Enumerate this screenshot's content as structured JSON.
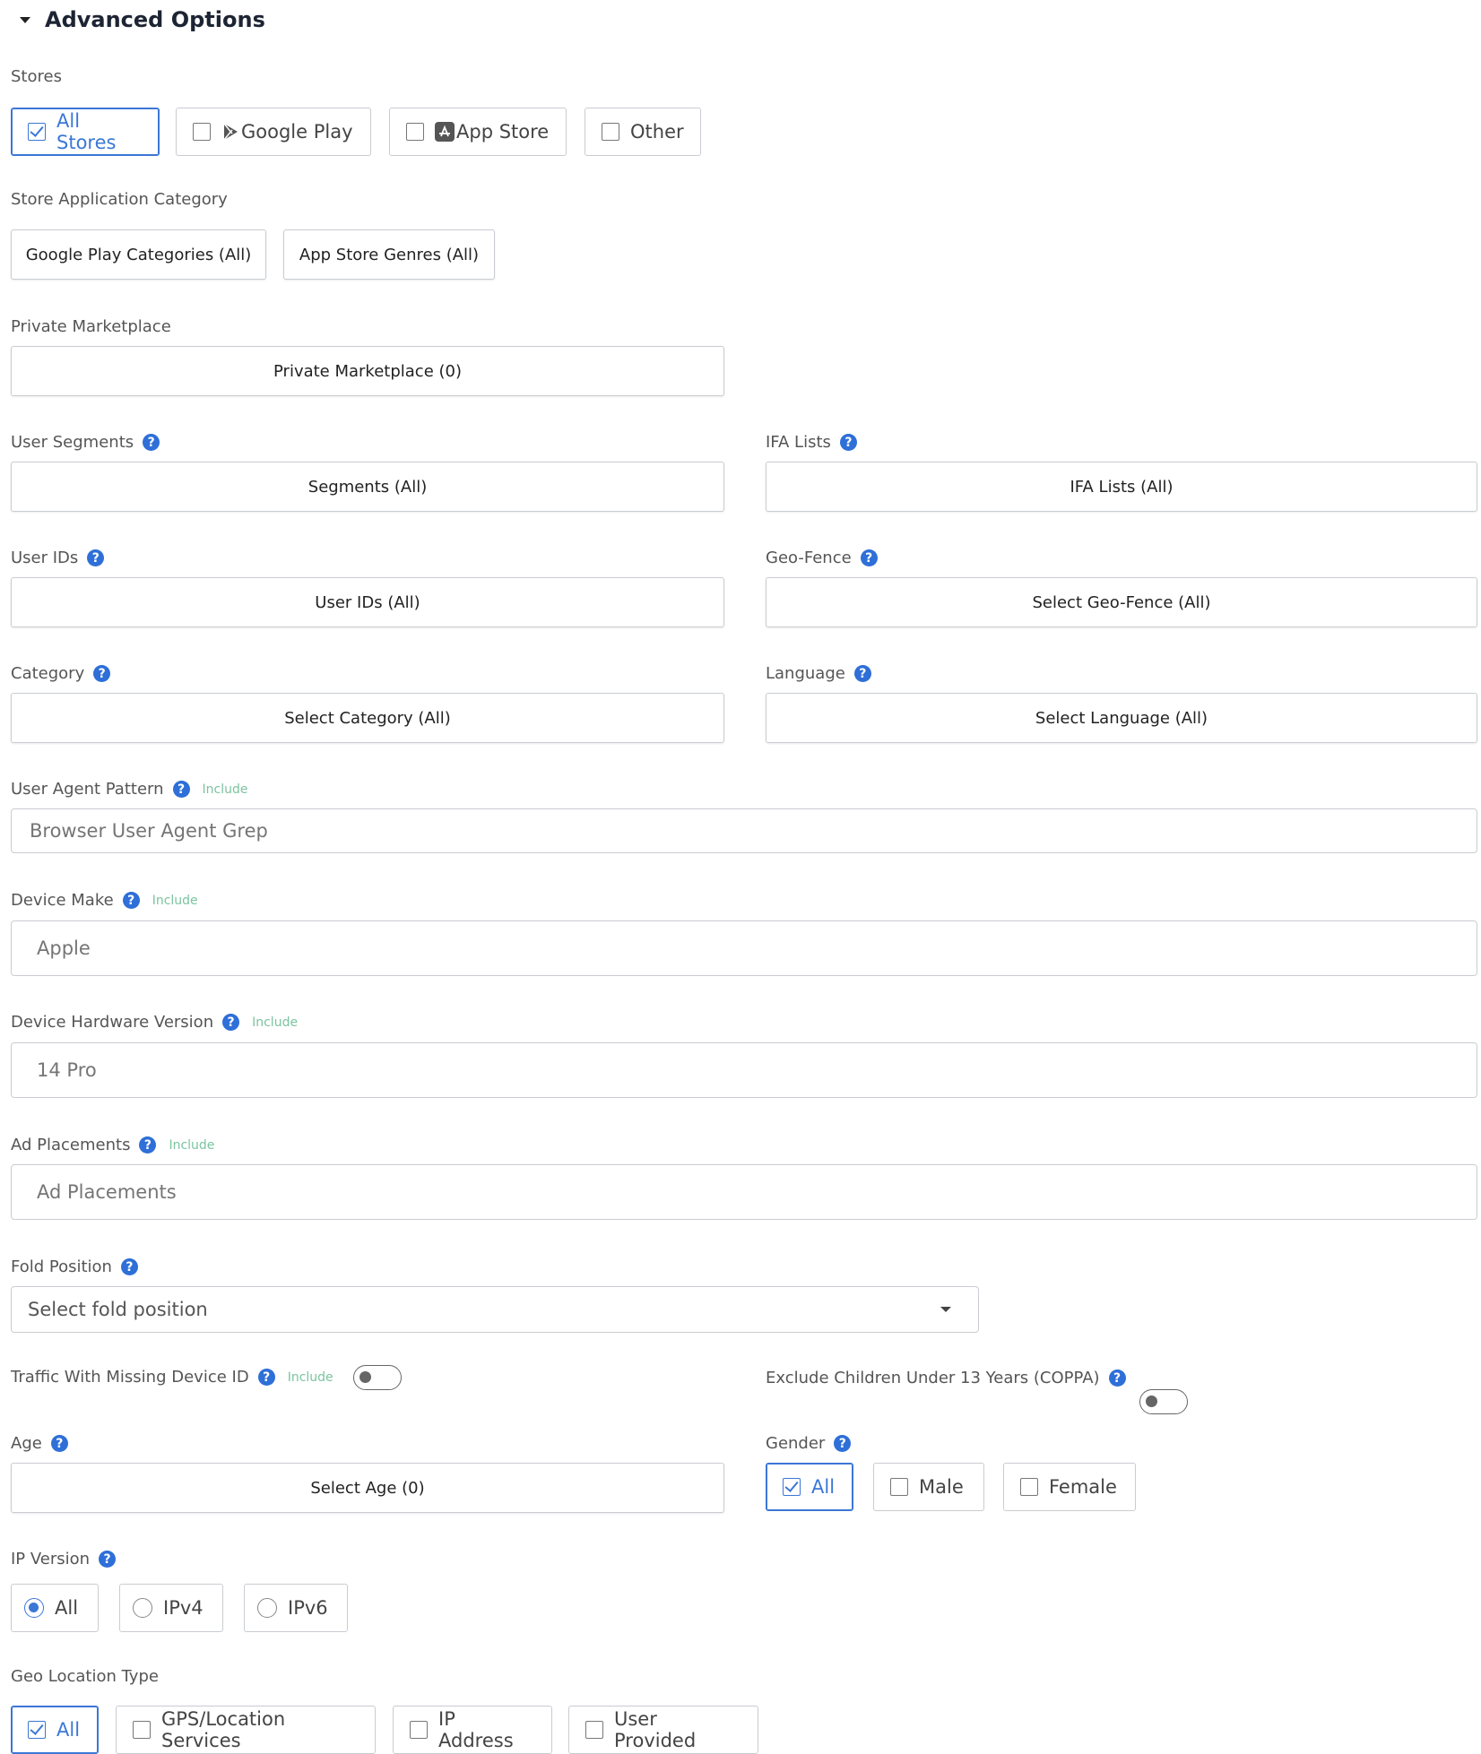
{
  "section": {
    "title": "Advanced Options"
  },
  "stores": {
    "label": "Stores",
    "options": [
      {
        "label": "All Stores",
        "checked": true
      },
      {
        "label": "Google Play",
        "checked": false,
        "icon": "google-play-icon"
      },
      {
        "label": "App Store",
        "checked": false,
        "icon": "app-store-icon"
      },
      {
        "label": "Other",
        "checked": false
      }
    ]
  },
  "store_category": {
    "label": "Store Application Category",
    "google_play": "Google Play Categories (All)",
    "app_store": "App Store Genres (All)"
  },
  "private_marketplace": {
    "label": "Private Marketplace",
    "button": "Private Marketplace (0)"
  },
  "user_segments": {
    "label": "User Segments",
    "button": "Segments (All)"
  },
  "ifa_lists": {
    "label": "IFA Lists",
    "button": "IFA Lists (All)"
  },
  "user_ids": {
    "label": "User IDs",
    "button": "User IDs (All)"
  },
  "geo_fence": {
    "label": "Geo-Fence",
    "button": "Select Geo-Fence (All)"
  },
  "category": {
    "label": "Category",
    "button": "Select Category (All)"
  },
  "language": {
    "label": "Language",
    "button": "Select Language (All)"
  },
  "user_agent": {
    "label": "User Agent Pattern",
    "tag": "Include",
    "placeholder": "Browser User Agent Grep"
  },
  "device_make": {
    "label": "Device Make",
    "tag": "Include",
    "placeholder": "Apple"
  },
  "device_hw": {
    "label": "Device Hardware Version",
    "tag": "Include",
    "placeholder": "14 Pro"
  },
  "ad_placements": {
    "label": "Ad Placements",
    "tag": "Include",
    "placeholder": "Ad Placements"
  },
  "fold_position": {
    "label": "Fold Position",
    "placeholder": "Select fold position"
  },
  "missing_device": {
    "label": "Traffic With Missing Device ID",
    "tag": "Include",
    "on": false
  },
  "coppa": {
    "label": "Exclude Children Under 13 Years (COPPA)",
    "on": false
  },
  "age": {
    "label": "Age",
    "button": "Select Age (0)"
  },
  "gender": {
    "label": "Gender",
    "options": [
      {
        "label": "All",
        "checked": true
      },
      {
        "label": "Male",
        "checked": false
      },
      {
        "label": "Female",
        "checked": false
      }
    ]
  },
  "ip_version": {
    "label": "IP Version",
    "options": [
      {
        "label": "All",
        "selected": true
      },
      {
        "label": "IPv4",
        "selected": false
      },
      {
        "label": "IPv6",
        "selected": false
      }
    ]
  },
  "geo_location_type": {
    "label": "Geo Location Type",
    "options": [
      {
        "label": "All",
        "checked": true
      },
      {
        "label": "GPS/Location Services",
        "checked": false
      },
      {
        "label": "IP Address",
        "checked": false
      },
      {
        "label": "User Provided",
        "checked": false
      }
    ]
  },
  "help_glyph": "?",
  "colors": {
    "accent": "#3b77d6",
    "help": "#2e6fd8",
    "include": "#7cc4a0"
  }
}
